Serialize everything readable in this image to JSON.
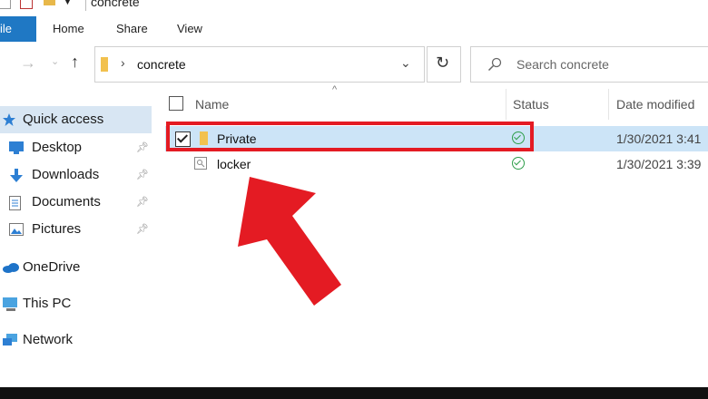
{
  "window": {
    "title": "concrete"
  },
  "ribbon": {
    "tabs": [
      "ile",
      "Home",
      "Share",
      "View"
    ]
  },
  "address": {
    "path_segment": "concrete",
    "search_placeholder": "Search concrete"
  },
  "sidebar": {
    "items": [
      {
        "label": "Quick access",
        "icon": "star-icon",
        "pinned": false,
        "selected": true
      },
      {
        "label": "Desktop",
        "icon": "desktop-icon",
        "pinned": true
      },
      {
        "label": "Downloads",
        "icon": "download-arrow-icon",
        "pinned": true
      },
      {
        "label": "Documents",
        "icon": "document-icon",
        "pinned": true
      },
      {
        "label": "Pictures",
        "icon": "pictures-icon",
        "pinned": true
      },
      {
        "label": "OneDrive",
        "icon": "cloud-icon",
        "pinned": false
      },
      {
        "label": "This PC",
        "icon": "computer-icon",
        "pinned": false
      },
      {
        "label": "Network",
        "icon": "network-icon",
        "pinned": false
      }
    ]
  },
  "filelist": {
    "columns": {
      "name": "Name",
      "status": "Status",
      "date": "Date modified"
    },
    "rows": [
      {
        "name": "Private",
        "date": "1/30/2021 3:41",
        "selected": true,
        "checked": true,
        "icon": "folder-icon"
      },
      {
        "name": "locker",
        "date": "1/30/2021 3:39",
        "selected": false,
        "checked": false,
        "icon": "file-icon"
      }
    ]
  },
  "colors": {
    "accent": "#1f78c4",
    "selection": "#cce4f7",
    "highlight": "#e41b23",
    "status_ok": "#2e9e4a"
  }
}
